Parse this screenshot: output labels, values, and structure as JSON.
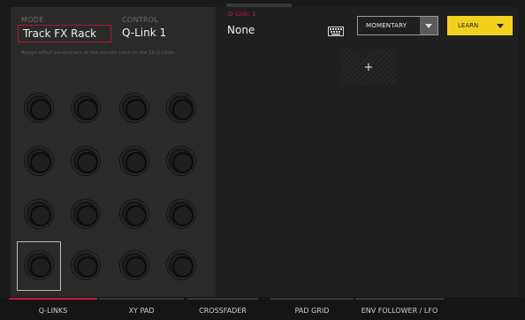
{
  "mode": {
    "label": "MODE",
    "value": "Track FX Rack"
  },
  "control": {
    "label": "CONTROL",
    "value": "Q-Link 1"
  },
  "hint": "Assign effect parameters of the current track to the 16 Q-Links",
  "qlink": {
    "title": "Q-Link: 1",
    "parameter": "None"
  },
  "keyboard_icon": "keyboard-icon",
  "momentary": {
    "label": "MOMENTARY"
  },
  "learn": {
    "label": "LEARN",
    "color": "#f1d11c"
  },
  "add_pad": {
    "symbol": "+"
  },
  "knobs": {
    "count": 16,
    "selected_index": 12
  },
  "tabs": [
    {
      "label": "Q-LINKS",
      "active": true
    },
    {
      "label": "XY PAD",
      "active": false
    },
    {
      "label": "CROSSFADER",
      "active": false
    },
    {
      "label": "PAD GRID",
      "active": false
    },
    {
      "label": "ENV FOLLOWER / LFO",
      "active": false
    }
  ],
  "colors": {
    "accent": "#c2193a",
    "learn": "#f1d11c",
    "panel": "#2a2a2a",
    "background": "#1a1a1a"
  }
}
